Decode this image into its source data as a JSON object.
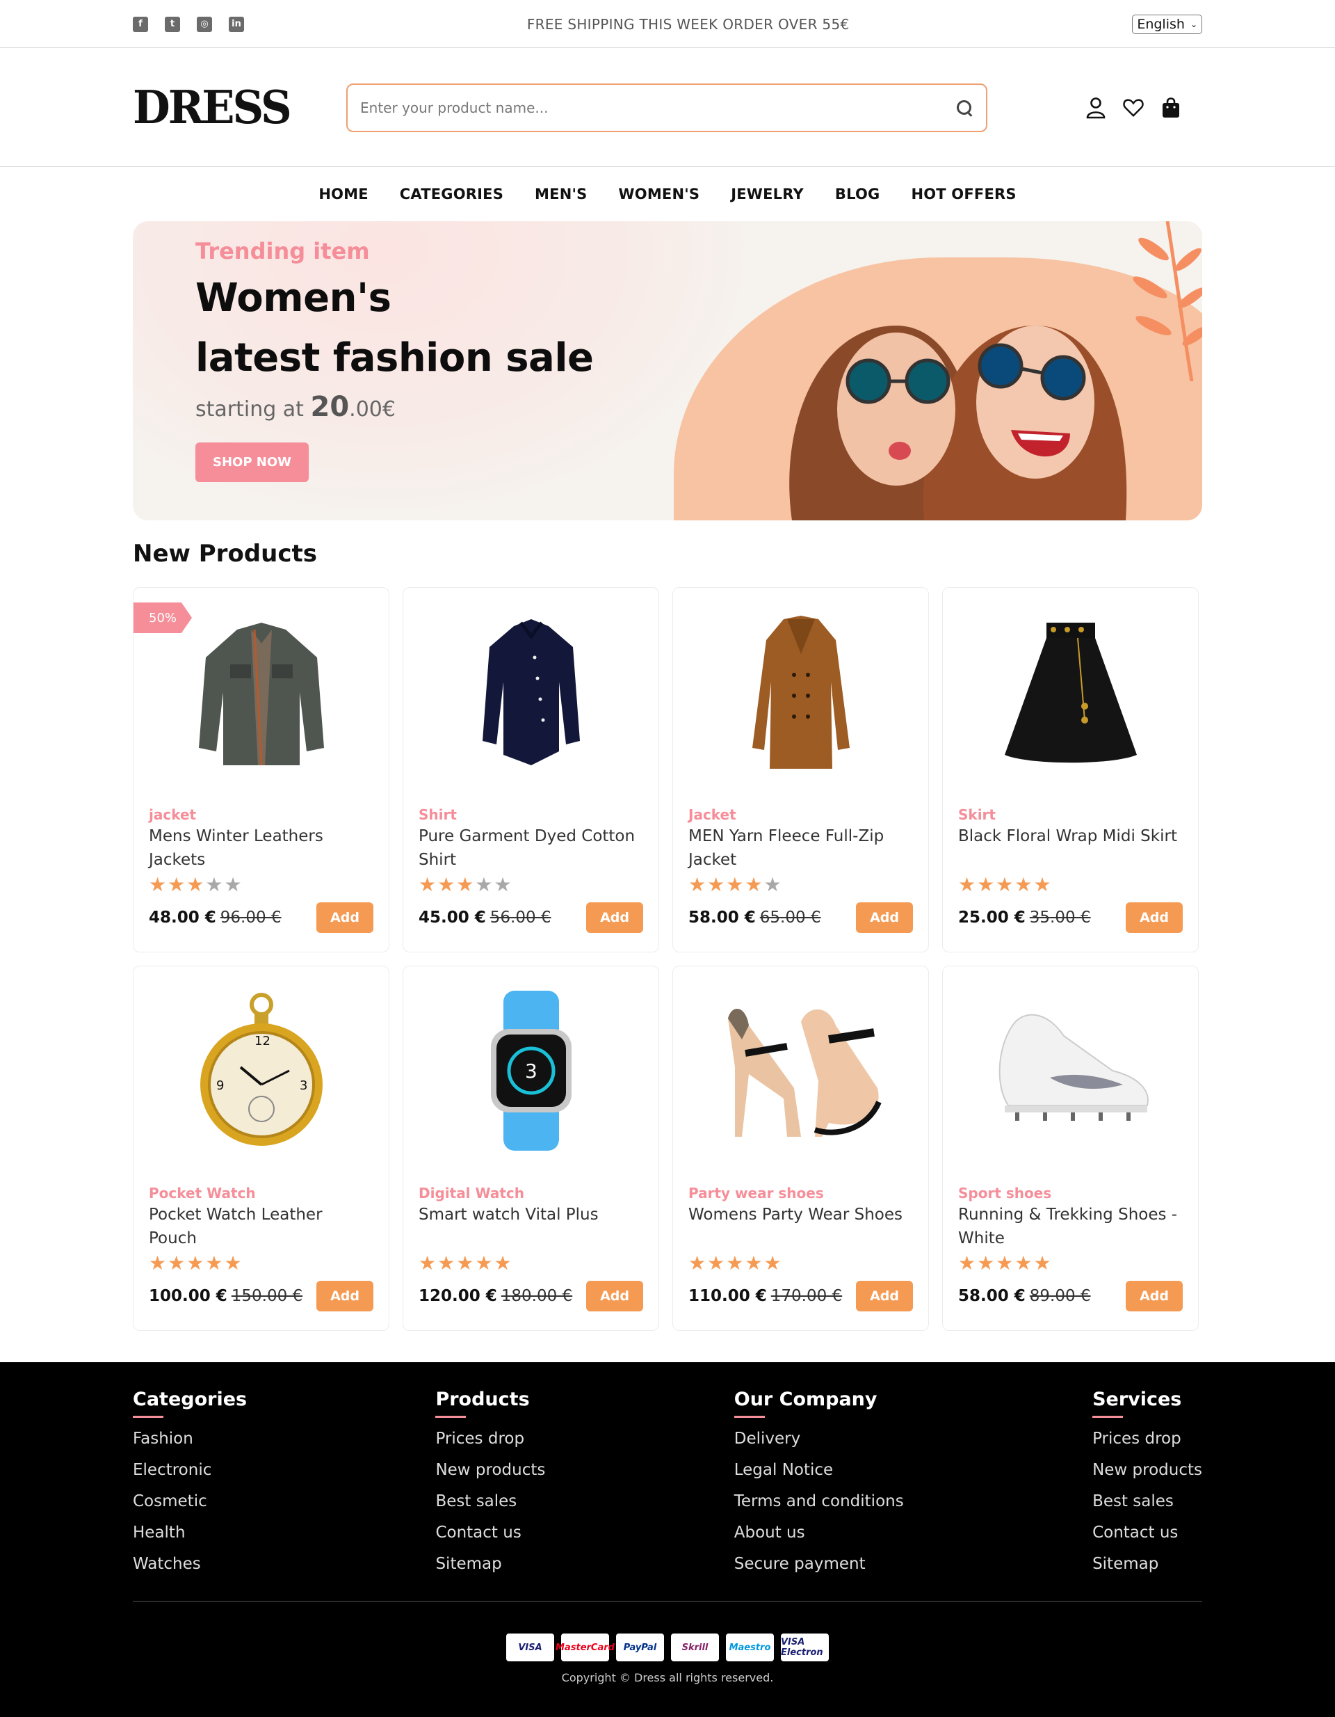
{
  "topbar": {
    "socials": [
      "facebook-icon",
      "twitter-icon",
      "instagram-icon",
      "linkedin-icon"
    ],
    "social_glyphs": [
      "f",
      "t",
      "◎",
      "in"
    ],
    "shipping": "FREE SHIPPING THIS WEEK ORDER OVER 55€",
    "language": "English"
  },
  "header": {
    "logo": "DRESS",
    "search_placeholder": "Enter your product name...",
    "icons": [
      "user-icon",
      "heart-icon",
      "bag-icon"
    ]
  },
  "nav": [
    "HOME",
    "CATEGORIES",
    "MEN'S",
    "WOMEN'S",
    "JEWELRY",
    "BLOG",
    "HOT OFFERS"
  ],
  "hero": {
    "kicker": "Trending item",
    "title_line1": "Women's",
    "title_line2": "latest fashion sale",
    "starting_prefix": "starting at ",
    "price_big": "20",
    "price_rest": ".00€",
    "button": "SHOP NOW"
  },
  "products_title": "New Products",
  "products": [
    {
      "badge": "50%",
      "category": "jacket",
      "name": "Mens Winter Leathers Jackets",
      "rating": 3,
      "price": "48.00 €",
      "old_price": "96.00 €",
      "image": "jacket-gray-image",
      "add": "Add"
    },
    {
      "badge": "",
      "category": "Shirt",
      "name": "Pure Garment Dyed Cotton Shirt",
      "rating": 3,
      "price": "45.00 €",
      "old_price": "56.00 €",
      "image": "navy-shirt-image",
      "add": "Add"
    },
    {
      "badge": "",
      "category": "Jacket",
      "name": "MEN Yarn Fleece Full-Zip Jacket",
      "rating": 4,
      "price": "58.00 €",
      "old_price": "65.00 €",
      "image": "brown-coat-image",
      "add": "Add"
    },
    {
      "badge": "",
      "category": "Skirt",
      "name": "Black Floral Wrap Midi Skirt",
      "rating": 5,
      "price": "25.00 €",
      "old_price": "35.00 €",
      "image": "black-skirt-image",
      "add": "Add"
    },
    {
      "badge": "",
      "category": "Pocket Watch",
      "name": "Pocket Watch Leather Pouch",
      "rating": 5,
      "price": "100.00 €",
      "old_price": "150.00 €",
      "image": "pocket-watch-image",
      "add": "Add"
    },
    {
      "badge": "",
      "category": "Digital Watch",
      "name": "Smart watch Vital Plus",
      "rating": 5,
      "price": "120.00 €",
      "old_price": "180.00 €",
      "image": "smart-watch-image",
      "add": "Add"
    },
    {
      "badge": "",
      "category": "Party wear shoes",
      "name": "Womens Party Wear Shoes",
      "rating": 5,
      "price": "110.00 €",
      "old_price": "170.00 €",
      "image": "party-heels-image",
      "add": "Add"
    },
    {
      "badge": "",
      "category": "Sport shoes",
      "name": "Running & Trekking Shoes - White",
      "rating": 5,
      "price": "58.00 €",
      "old_price": "89.00 €",
      "image": "white-sneaker-image",
      "add": "Add"
    }
  ],
  "footer": {
    "columns": [
      {
        "title": "Categories",
        "links": [
          "Fashion",
          "Electronic",
          "Cosmetic",
          "Health",
          "Watches"
        ]
      },
      {
        "title": "Products",
        "links": [
          "Prices drop",
          "New products",
          "Best sales",
          "Contact us",
          "Sitemap"
        ]
      },
      {
        "title": "Our Company",
        "links": [
          "Delivery",
          "Legal Notice",
          "Terms and conditions",
          "About us",
          "Secure payment"
        ]
      },
      {
        "title": "Services",
        "links": [
          "Prices drop",
          "New products",
          "Best sales",
          "Contact us",
          "Sitemap"
        ]
      }
    ],
    "payments": [
      {
        "label": "VISA",
        "color": "#1a1f71"
      },
      {
        "label": "MasterCard",
        "color": "#eb001b"
      },
      {
        "label": "PayPal",
        "color": "#003087"
      },
      {
        "label": "Skrill",
        "color": "#862165"
      },
      {
        "label": "Maestro",
        "color": "#0099df"
      },
      {
        "label": "VISA Electron",
        "color": "#1a1f71"
      }
    ],
    "copyright": "Copyright © Dress all rights reserved."
  },
  "colors": {
    "accent_pink": "#f58e99",
    "accent_orange": "#f59a53",
    "footer_bg": "#000000"
  }
}
